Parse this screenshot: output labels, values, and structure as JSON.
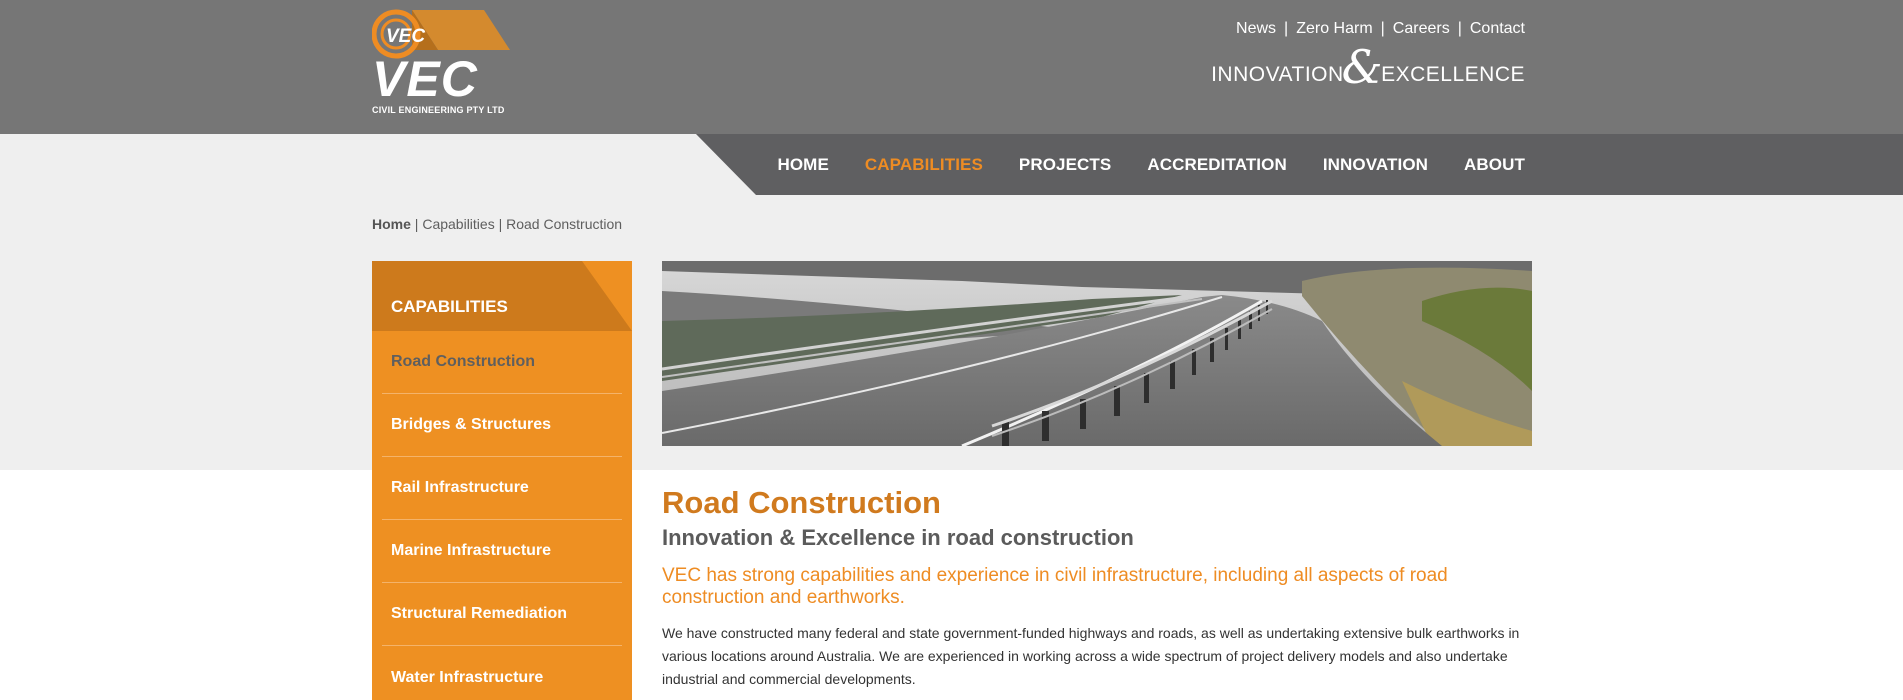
{
  "brand": {
    "logo_text": "VEC",
    "logo_mark": "VEC",
    "logo_sub": "CIVIL ENGINEERING PTY LTD",
    "tagline_left": "INNOVATION",
    "tagline_amp": "&",
    "tagline_right": "EXCELLENCE",
    "colors": {
      "orange": "#ee8c23",
      "dark_orange": "#cd7a1c",
      "header_grey": "#767676",
      "nav_grey": "#5f5f61"
    }
  },
  "toplinks": [
    {
      "label": "News"
    },
    {
      "label": "Zero Harm"
    },
    {
      "label": "Careers"
    },
    {
      "label": "Contact"
    }
  ],
  "toplinks_sep": "|",
  "nav": [
    {
      "label": "HOME"
    },
    {
      "label": "CAPABILITIES"
    },
    {
      "label": "PROJECTS"
    },
    {
      "label": "ACCREDITATION"
    },
    {
      "label": "INNOVATION"
    },
    {
      "label": "ABOUT"
    }
  ],
  "breadcrumb": {
    "home": "Home",
    "sep": " | ",
    "level1": "Capabilities",
    "current": "Road Construction"
  },
  "sidebar": {
    "title": "CAPABILITIES",
    "items": [
      {
        "label": "Road Construction"
      },
      {
        "label": "Bridges & Structures"
      },
      {
        "label": "Rail Infrastructure"
      },
      {
        "label": "Marine Infrastructure"
      },
      {
        "label": "Structural Remediation"
      },
      {
        "label": "Water Infrastructure"
      }
    ]
  },
  "hero": {
    "icon": "road-photo"
  },
  "content": {
    "title": "Road Construction",
    "subtitle": "Innovation & Excellence in road construction",
    "intro": "VEC has strong capabilities and experience in civil infrastructure, including all aspects of road construction and earthworks.",
    "body": "We have constructed many federal and state government-funded highways and roads, as well as undertaking extensive bulk earthworks in various locations around Australia. We are experienced in working across a wide spectrum of project delivery models and also undertake industrial and commercial developments."
  }
}
